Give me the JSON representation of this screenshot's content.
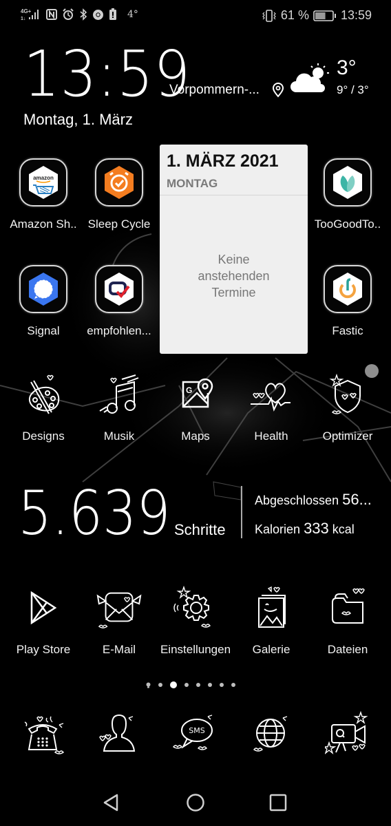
{
  "status_bar": {
    "network_label": "4G+",
    "left_icons": [
      "signal-icon",
      "nfc-icon",
      "alarm-icon",
      "bluetooth-icon",
      "chrome-icon",
      "battery-saver-icon"
    ],
    "left_temp": "4°",
    "battery_percent": "61 %",
    "battery_level": 0.61,
    "time": "13:59"
  },
  "clock_widget": {
    "time": "13:59",
    "location": "Vorpommern-...",
    "weather_icon": "partly-cloudy-icon",
    "temperature": "3°",
    "temp_range": "9° / 3°",
    "date": "Montag, 1. März"
  },
  "calendar_widget": {
    "date": "1. MÄRZ 2021",
    "weekday": "MONTAG",
    "empty_message": "Keine anstehenden Termine"
  },
  "apps_row1": [
    {
      "label": "Amazon Sh..",
      "icon": "amazon-shopping-icon"
    },
    {
      "label": "Sleep Cycle",
      "icon": "sleep-cycle-icon"
    },
    {
      "label": "TooGoodTo..",
      "icon": "toogoodtogo-icon"
    }
  ],
  "apps_row2": [
    {
      "label": "Signal",
      "icon": "signal-messenger-icon"
    },
    {
      "label": "empfohlen...",
      "icon": "empfohlen-icon"
    },
    {
      "label": "Fastic",
      "icon": "fastic-icon"
    }
  ],
  "apps_row3": [
    {
      "label": "Designs",
      "icon": "palette-icon"
    },
    {
      "label": "Musik",
      "icon": "music-note-icon"
    },
    {
      "label": "Maps",
      "icon": "maps-icon"
    },
    {
      "label": "Health",
      "icon": "heart-pulse-icon"
    },
    {
      "label": "Optimizer",
      "icon": "shield-icon"
    }
  ],
  "health_widget": {
    "steps": "5.639",
    "steps_unit": "Schritte",
    "completed_label": "Abgeschlossen",
    "completed_value": "56...",
    "calories_label": "Kalorien",
    "calories_value": "333",
    "calories_unit": "kcal"
  },
  "apps_row4": [
    {
      "label": "Play Store",
      "icon": "play-store-icon"
    },
    {
      "label": "E-Mail",
      "icon": "email-icon"
    },
    {
      "label": "Einstellungen",
      "icon": "settings-gear-icon"
    },
    {
      "label": "Galerie",
      "icon": "gallery-icon"
    },
    {
      "label": "Dateien",
      "icon": "folder-icon"
    }
  ],
  "page_indicator": {
    "total_pages": 7,
    "active_page": 2
  },
  "dock": [
    {
      "name": "phone",
      "icon": "phone-icon"
    },
    {
      "name": "contacts",
      "icon": "contacts-icon"
    },
    {
      "name": "messages",
      "icon": "sms-icon",
      "text": "SMS"
    },
    {
      "name": "browser",
      "icon": "globe-icon"
    },
    {
      "name": "camera",
      "icon": "video-camera-icon"
    }
  ],
  "navigation": {
    "back": "back-icon",
    "home": "home-icon",
    "recents": "recents-icon"
  }
}
